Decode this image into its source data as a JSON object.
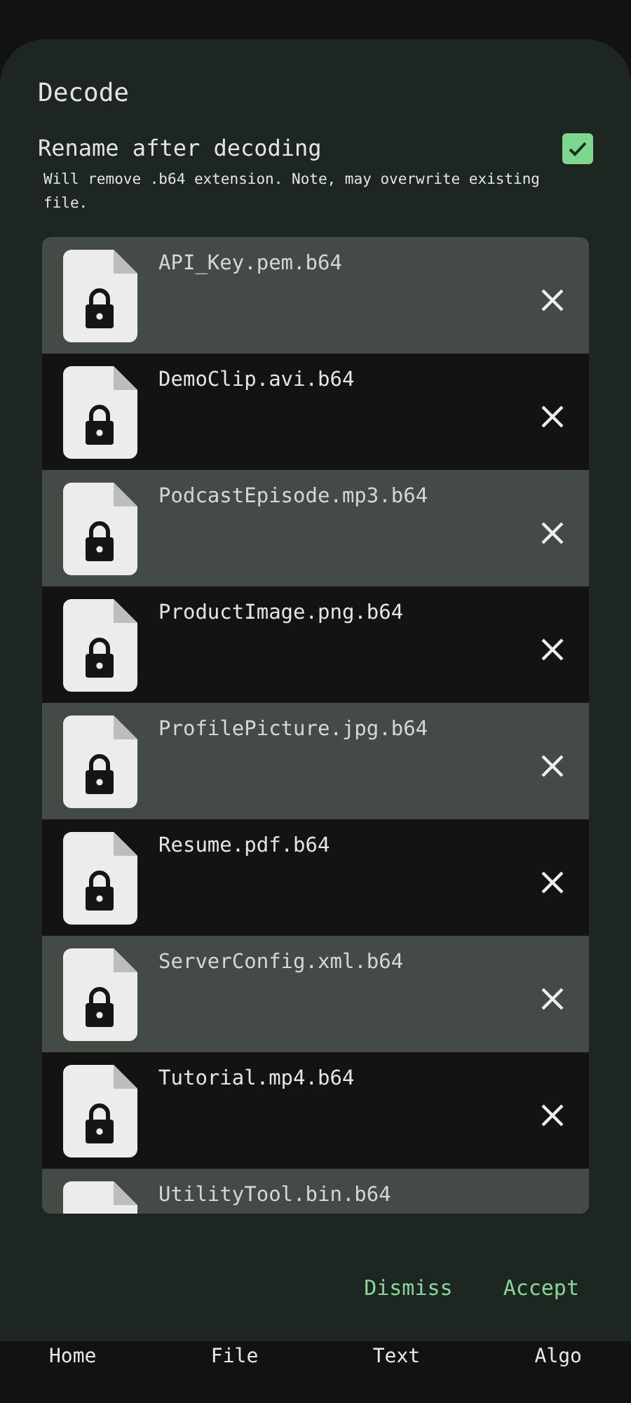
{
  "dialog": {
    "title": "Decode",
    "option": {
      "label": "Rename after decoding",
      "checked": true,
      "note": "Will remove .b64 extension. Note, may overwrite existing file."
    },
    "files": [
      {
        "name": "API_Key.pem.b64"
      },
      {
        "name": "DemoClip.avi.b64"
      },
      {
        "name": "PodcastEpisode.mp3.b64"
      },
      {
        "name": "ProductImage.png.b64"
      },
      {
        "name": "ProfilePicture.jpg.b64"
      },
      {
        "name": "Resume.pdf.b64"
      },
      {
        "name": "ServerConfig.xml.b64"
      },
      {
        "name": "Tutorial.mp4.b64"
      },
      {
        "name": "UtilityTool.bin.b64",
        "cut_off": true
      }
    ],
    "buttons": [
      "Dismiss",
      "Accept"
    ]
  },
  "bottom_nav": [
    "Home",
    "File",
    "Text",
    "Algo"
  ]
}
